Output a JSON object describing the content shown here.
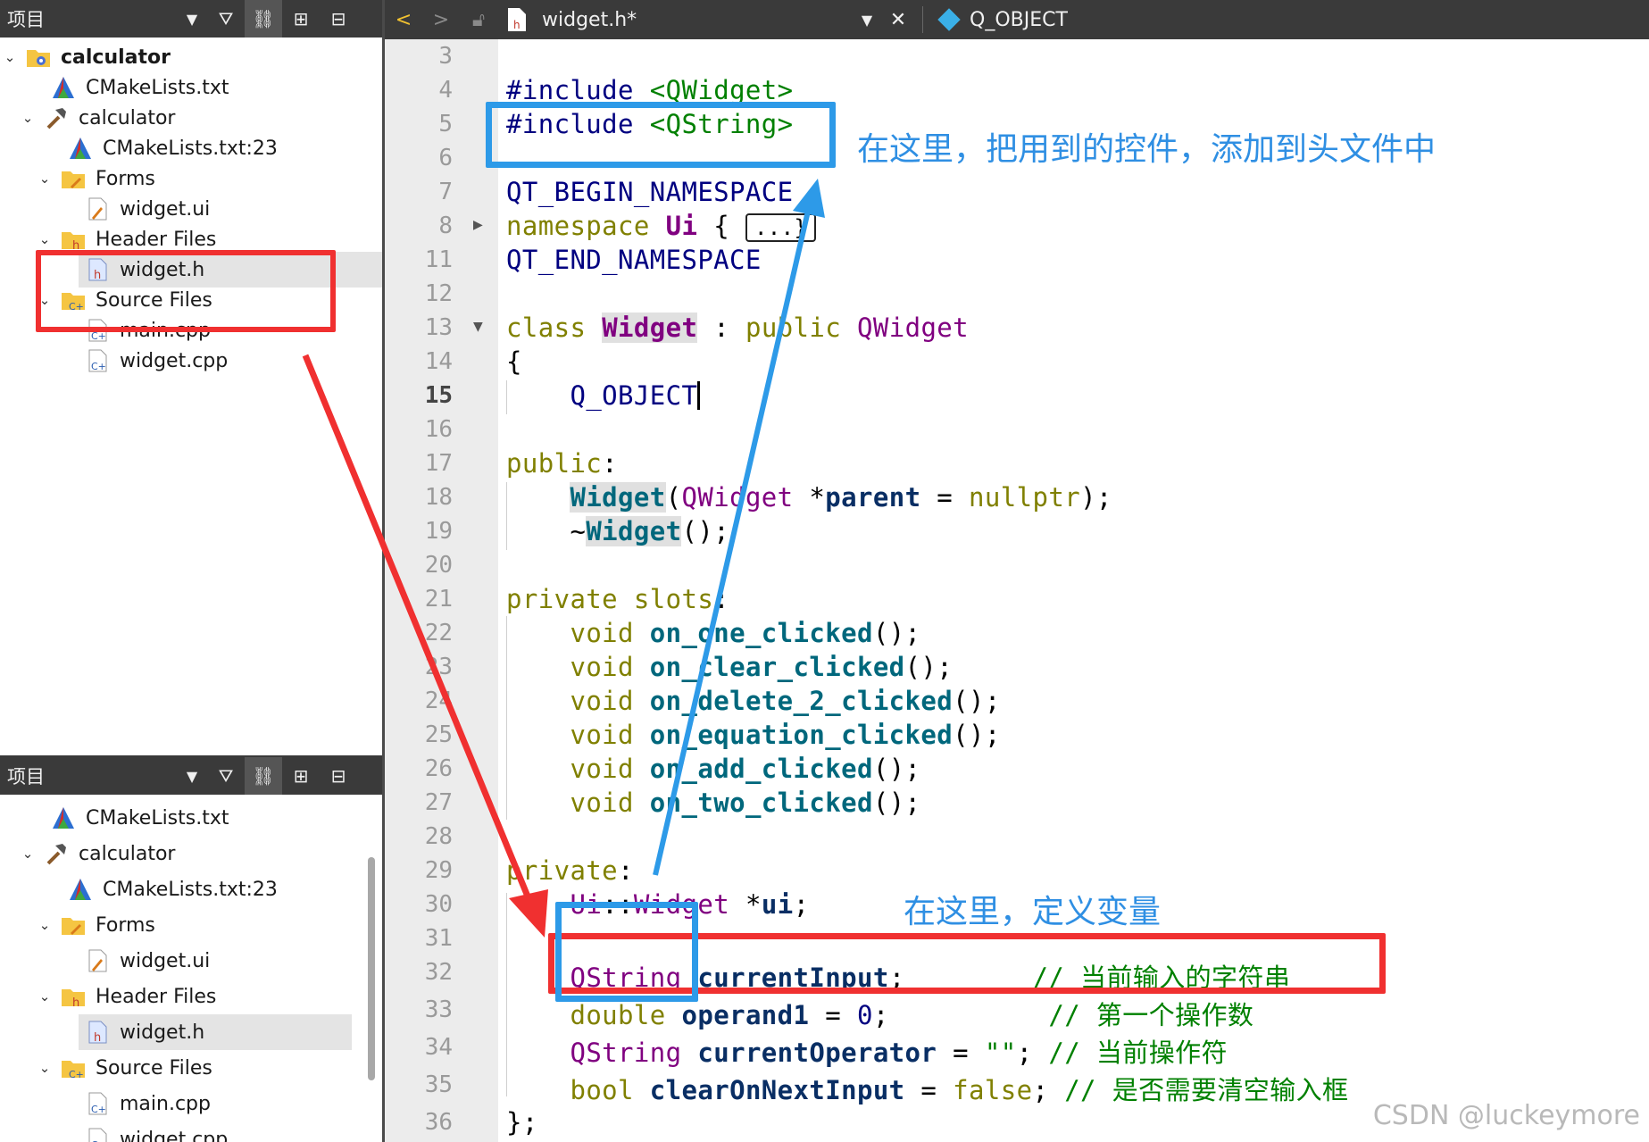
{
  "project_panel_top": {
    "title": "项目",
    "items": [
      {
        "label": "calculator",
        "bold": true
      },
      {
        "label": "CMakeLists.txt"
      },
      {
        "label": "calculator"
      },
      {
        "label": "CMakeLists.txt:23"
      },
      {
        "label": "Forms"
      },
      {
        "label": "widget.ui"
      },
      {
        "label": "Header Files"
      },
      {
        "label": "widget.h",
        "selected": true
      },
      {
        "label": "Source Files"
      },
      {
        "label": "main.cpp"
      },
      {
        "label": "widget.cpp"
      }
    ]
  },
  "project_panel_bottom": {
    "title": "项目",
    "items": [
      {
        "label": "CMakeLists.txt"
      },
      {
        "label": "calculator"
      },
      {
        "label": "CMakeLists.txt:23"
      },
      {
        "label": "Forms"
      },
      {
        "label": "widget.ui"
      },
      {
        "label": "Header Files"
      },
      {
        "label": "widget.h",
        "selected": true
      },
      {
        "label": "Source Files"
      },
      {
        "label": "main.cpp"
      },
      {
        "label": "widget.cpp"
      }
    ]
  },
  "editor_toolbar": {
    "file_name": "widget.h*",
    "symbol": "Q_OBJECT",
    "icons": [
      "back-arrow-icon",
      "forward-arrow-icon",
      "lock-icon",
      "header-file-icon",
      "dropdown-icon",
      "close-icon",
      "symbol-diamond-icon"
    ]
  },
  "editor": {
    "current_line": "15",
    "line_numbers": [
      "3",
      "4",
      "5",
      "6",
      "7",
      "8",
      "11",
      "12",
      "13",
      "14",
      "15",
      "16",
      "17",
      "18",
      "19",
      "20",
      "21",
      "22",
      "23",
      "24",
      "25",
      "26",
      "27",
      "28",
      "29",
      "30",
      "31",
      "32",
      "33",
      "34",
      "35",
      "36"
    ],
    "collapsed_block": "...}"
  },
  "annotations": {
    "include_note": "在这里，把用到的控件，添加到头文件中",
    "define_note": "在这里，定义变量",
    "colors": {
      "red": "#f03030",
      "blue": "#2d9ae8"
    }
  },
  "watermark": "CSDN @luckeymore"
}
